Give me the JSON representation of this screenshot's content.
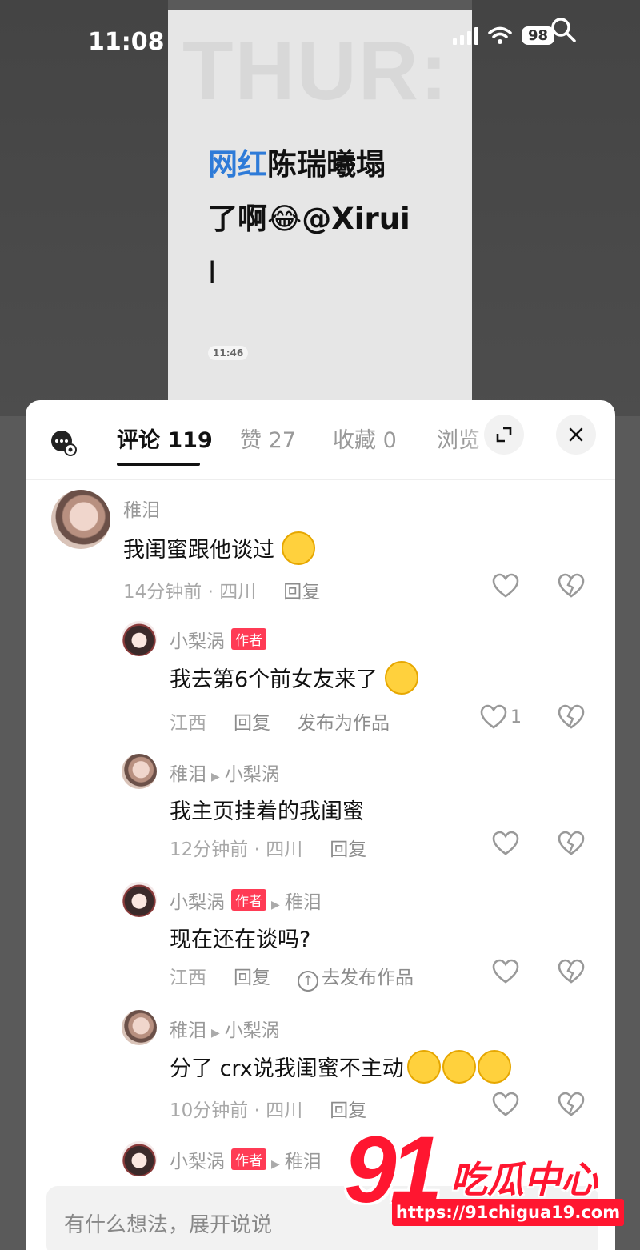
{
  "status_bar": {
    "time": "11:08",
    "battery": "98"
  },
  "video": {
    "watermark_text": "THUR:",
    "caption_highlight": "网红",
    "caption_rest": "陈瑞曦塌",
    "caption_line2": "了啊😂@Xirui",
    "caption_line3": "l",
    "timestamp": "11:46"
  },
  "tabs": [
    {
      "label": "评论 119"
    },
    {
      "label": "赞 27"
    },
    {
      "label": "收藏 0"
    },
    {
      "label": "浏览"
    }
  ],
  "comments": [
    {
      "name": "稚泪",
      "text": "我闺蜜跟他谈过",
      "meta": "14分钟前 · 四川",
      "reply": "回复",
      "likes": ""
    },
    {
      "name": "小梨涡",
      "badge": "作者",
      "text": "我去第6个前女友来了",
      "meta": "江西",
      "reply": "回复",
      "extra": "发布为作品",
      "likes": "1"
    },
    {
      "name": "稚泪",
      "reply_to": "小梨涡",
      "text": "我主页挂着的我闺蜜",
      "meta": "12分钟前 · 四川",
      "reply": "回复",
      "likes": ""
    },
    {
      "name": "小梨涡",
      "badge": "作者",
      "reply_to": "稚泪",
      "text": "现在还在谈吗?",
      "meta": "江西",
      "reply": "回复",
      "extra": "去发布作品",
      "likes": ""
    },
    {
      "name": "稚泪",
      "reply_to": "小梨涡",
      "text": "分了 crx说我闺蜜不主动",
      "meta": "10分钟前 · 四川",
      "reply": "回复",
      "likes": ""
    },
    {
      "name": "小梨涡",
      "badge": "作者",
      "reply_to": "稚泪"
    }
  ],
  "input": {
    "placeholder": "有什么想法，展开说说"
  },
  "site_watermark": {
    "number": "91",
    "name": "吃瓜中心",
    "url": "https://91chigua19.com"
  },
  "colors": {
    "author_badge": "#ff3b55",
    "highlight": "#2e7bd8",
    "watermark_red": "#ff1630"
  }
}
